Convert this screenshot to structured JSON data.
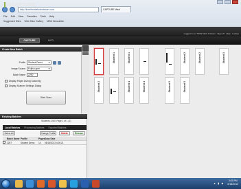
{
  "browser": {
    "address": "http://localhost/studentscan.com",
    "tab_title": "CAPTURE Web",
    "menu": [
      "File",
      "Edit",
      "View",
      "Favorites",
      "Tools",
      "Help"
    ],
    "favorites": [
      "Suggested Sites",
      "Web Slice Gallery",
      "MSN Newsletter"
    ]
  },
  "app": {
    "logo": "inCAPTURE",
    "user_line": "Logged in as: TSSS Mark Johnson · Sign off · Help · Lookup",
    "tabs": [
      "CAPTURE",
      "MCD"
    ]
  },
  "create_batch": {
    "heading": "Create New Batch",
    "profile_label": "Profile",
    "profile_value": "Student Demo",
    "source_label": "Image Source",
    "source_value": "Fujitsu ppm",
    "batch_label": "Batch Name",
    "batch_value": "2290",
    "checkbox1": "Display Pages During Scanning",
    "checkbox2": "Display Scanner Settings Dialog",
    "start_button": "Start Scan"
  },
  "existing_batches": {
    "heading": "Existing Batches",
    "pages_line": "Students: 2087  Page 1  of 1 (1)",
    "subtabs": [
      "Local Batches",
      "Processing Batches",
      "Exported Batches"
    ],
    "buttons": [
      "Select All",
      "Change Profile",
      "Delete",
      "Release"
    ],
    "columns": [
      "",
      "Batch Name",
      "Profile",
      "Pages",
      "Scan Date"
    ],
    "rows": [
      [
        "",
        "2287",
        "Student Demo",
        "14",
        "06/18/2013 4:06:21"
      ]
    ]
  },
  "thumbnails": {
    "row1": [
      "",
      "Student 1",
      "Student 1",
      "",
      "",
      "Student 2",
      "Student 2",
      "Student 3"
    ],
    "row2": [
      "Student 3",
      "",
      "Student 4",
      "Student 4",
      "Student 5",
      "Student 5"
    ]
  },
  "taskbar": {
    "apps": [
      "explorer",
      "ie",
      "media",
      "firefox",
      "files",
      "skype",
      "word",
      "powerpoint"
    ],
    "time": "3:03 PM",
    "date": "6/18/2013"
  }
}
